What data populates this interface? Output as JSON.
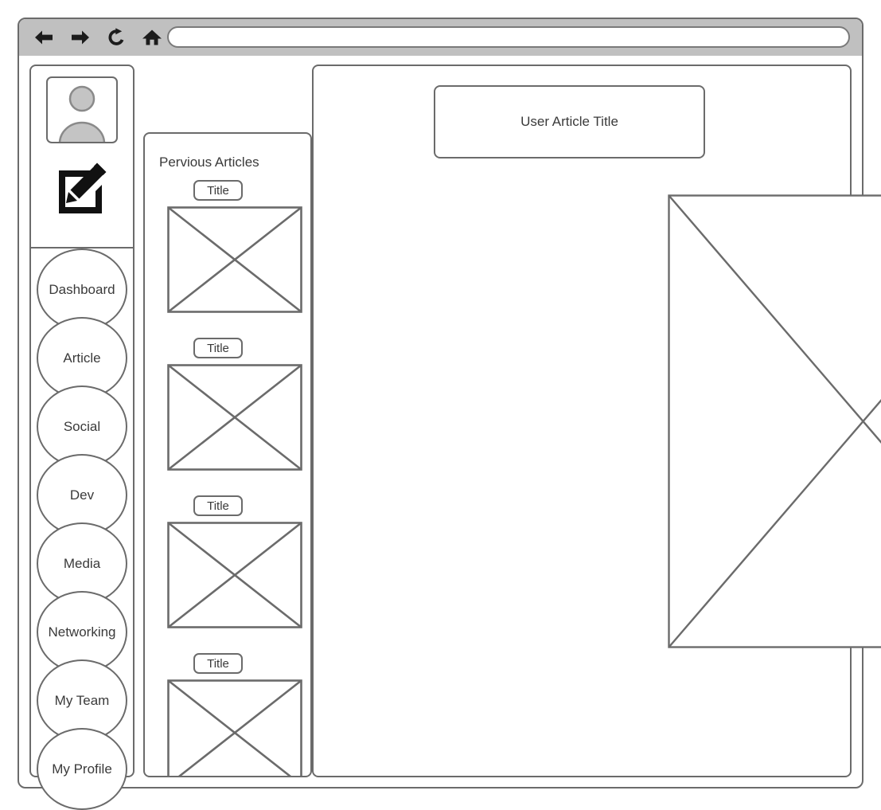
{
  "browser": {
    "back_icon": "arrow-left-icon",
    "forward_icon": "arrow-right-icon",
    "reload_icon": "reload-icon",
    "home_icon": "home-icon",
    "url_value": "",
    "url_placeholder": ""
  },
  "sidebar": {
    "avatar_icon": "user-avatar-icon",
    "compose_icon": "compose-edit-icon",
    "nav_items": [
      {
        "label": "Dashboard"
      },
      {
        "label": "Article"
      },
      {
        "label": "Social"
      },
      {
        "label": "Dev"
      },
      {
        "label": "Media"
      },
      {
        "label": "Networking"
      },
      {
        "label": "My Team"
      },
      {
        "label": "My Profile"
      }
    ]
  },
  "previous_panel": {
    "title": "Pervious Articles",
    "articles": [
      {
        "title": "Title",
        "thumbnail_icon": "image-placeholder-icon"
      },
      {
        "title": "Title",
        "thumbnail_icon": "image-placeholder-icon"
      },
      {
        "title": "Title",
        "thumbnail_icon": "image-placeholder-icon"
      },
      {
        "title": "Title",
        "thumbnail_icon": "image-placeholder-icon"
      }
    ]
  },
  "main": {
    "article_title": "User Article Title",
    "hero_icon": "image-placeholder-icon"
  },
  "colors": {
    "toolbar_background": "#c0c0c0",
    "stroke": "#6b6b6b",
    "text": "#3a3a3a",
    "avatar_fill": "#c4c4c4",
    "compose_icon": "#111111",
    "panel_background": "#ffffff"
  }
}
